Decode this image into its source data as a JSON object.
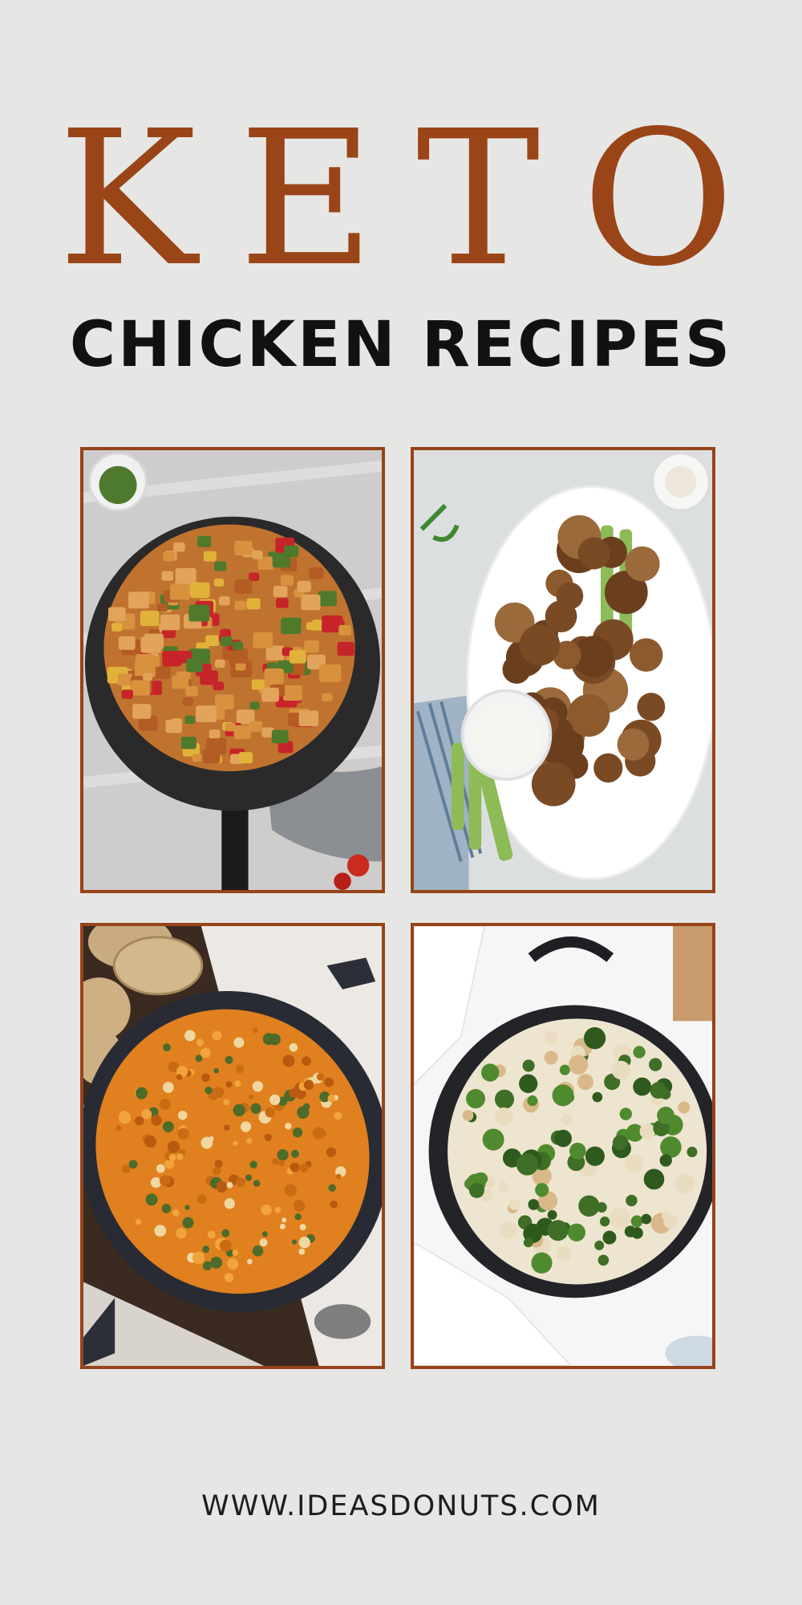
{
  "header": {
    "title": "KETO",
    "subtitle": "CHICKEN RECIPES"
  },
  "colors": {
    "accent": "#9a4518",
    "background": "#e6e7e4",
    "text": "#111111"
  },
  "recipes": [
    {
      "image": "chicken-vegetable-skillet-photo"
    },
    {
      "image": "chicken-wings-platter-photo"
    },
    {
      "image": "cheesy-chicken-casserole-photo"
    },
    {
      "image": "chicken-broccoli-skillet-photo"
    }
  ],
  "footer": {
    "url": "WWW.IDEASDONUTS.COM"
  }
}
